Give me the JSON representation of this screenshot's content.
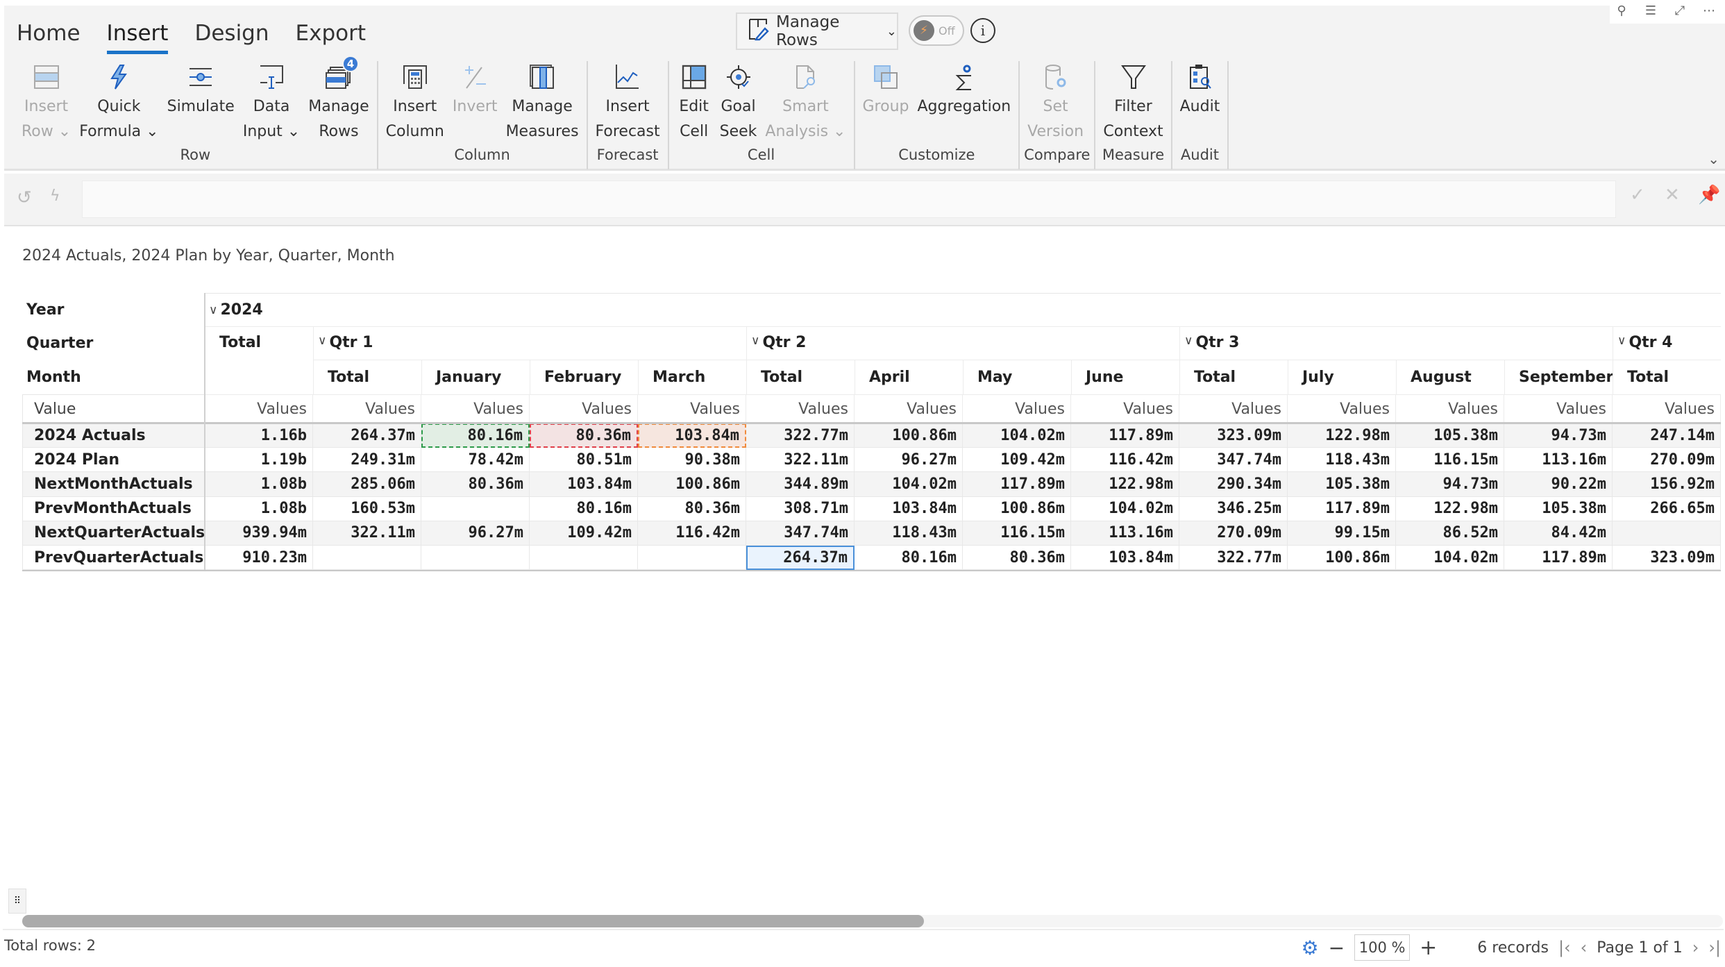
{
  "window_controls": [
    "pin-icon",
    "filter-icon",
    "expand-icon",
    "more-icon"
  ],
  "tabs": [
    {
      "label": "Home",
      "active": false
    },
    {
      "label": "Insert",
      "active": true
    },
    {
      "label": "Design",
      "active": false
    },
    {
      "label": "Export",
      "active": false
    }
  ],
  "manage_rows_dropdown": {
    "label": "Manage Rows"
  },
  "toggle": {
    "label": "Off",
    "state": "off"
  },
  "ribbon_groups": [
    {
      "label": "Row",
      "buttons": [
        {
          "line1": "Insert",
          "line2": "Row",
          "dropdown": true,
          "disabled": true,
          "icon": "insert-row-icon"
        },
        {
          "line1": "Quick",
          "line2": "Formula",
          "dropdown": true,
          "disabled": false,
          "icon": "lightning-icon"
        },
        {
          "line1": "Simulate",
          "line2": "",
          "dropdown": false,
          "disabled": false,
          "icon": "slider-icon"
        },
        {
          "line1": "Data",
          "line2": "Input",
          "dropdown": true,
          "disabled": false,
          "icon": "data-input-icon"
        },
        {
          "line1": "Manage",
          "line2": "Rows",
          "dropdown": false,
          "disabled": false,
          "icon": "manage-rows-icon",
          "badge": "4"
        }
      ]
    },
    {
      "label": "Column",
      "buttons": [
        {
          "line1": "Insert",
          "line2": "Column",
          "dropdown": false,
          "disabled": false,
          "icon": "calculator-icon"
        },
        {
          "line1": "Invert",
          "line2": "",
          "dropdown": false,
          "disabled": true,
          "icon": "plus-minus-icon"
        },
        {
          "line1": "Manage",
          "line2": "Measures",
          "dropdown": false,
          "disabled": false,
          "icon": "manage-measures-icon"
        }
      ]
    },
    {
      "label": "Forecast",
      "buttons": [
        {
          "line1": "Insert",
          "line2": "Forecast",
          "dropdown": false,
          "disabled": false,
          "icon": "line-chart-icon"
        }
      ]
    },
    {
      "label": "Cell",
      "buttons": [
        {
          "line1": "Edit",
          "line2": "Cell",
          "dropdown": false,
          "disabled": false,
          "icon": "edit-cell-icon"
        },
        {
          "line1": "Goal",
          "line2": "Seek",
          "dropdown": false,
          "disabled": false,
          "icon": "target-icon"
        },
        {
          "line1": "Smart",
          "line2": "Analysis",
          "dropdown": true,
          "disabled": true,
          "icon": "document-search-icon"
        }
      ]
    },
    {
      "label": "Customize",
      "buttons": [
        {
          "line1": "Group",
          "line2": "",
          "dropdown": false,
          "disabled": true,
          "icon": "group-icon"
        },
        {
          "line1": "Aggregation",
          "line2": "",
          "dropdown": false,
          "disabled": false,
          "icon": "sigma-gear-icon"
        }
      ]
    },
    {
      "label": "Compare",
      "buttons": [
        {
          "line1": "Set",
          "line2": "Version",
          "dropdown": false,
          "disabled": true,
          "icon": "database-gear-icon"
        }
      ]
    },
    {
      "label": "Measure",
      "buttons": [
        {
          "line1": "Filter",
          "line2": "Context",
          "dropdown": false,
          "disabled": false,
          "icon": "funnel-icon"
        }
      ]
    },
    {
      "label": "Audit",
      "buttons": [
        {
          "line1": "Audit",
          "line2": "",
          "dropdown": false,
          "disabled": false,
          "icon": "clipboard-search-icon"
        }
      ]
    }
  ],
  "formula_bar": {
    "value": "",
    "placeholder": ""
  },
  "report_title": "2024 Actuals, 2024 Plan by Year, Quarter, Month",
  "table": {
    "dim_labels": {
      "year": "Year",
      "quarter": "Quarter",
      "month": "Month",
      "value": "Value"
    },
    "year": "2024",
    "quarters": [
      {
        "label": "Total",
        "collapsible": false
      },
      {
        "label": "Qtr 1",
        "collapsible": true
      },
      {
        "label": "Qtr 2",
        "collapsible": true
      },
      {
        "label": "Qtr 3",
        "collapsible": true
      },
      {
        "label": "Qtr 4",
        "collapsible": true
      }
    ],
    "columns": [
      {
        "quarter": "Total",
        "month": ""
      },
      {
        "quarter": "Qtr 1",
        "month": "Total"
      },
      {
        "quarter": "Qtr 1",
        "month": "January"
      },
      {
        "quarter": "Qtr 1",
        "month": "February"
      },
      {
        "quarter": "Qtr 1",
        "month": "March"
      },
      {
        "quarter": "Qtr 2",
        "month": "Total"
      },
      {
        "quarter": "Qtr 2",
        "month": "April"
      },
      {
        "quarter": "Qtr 2",
        "month": "May"
      },
      {
        "quarter": "Qtr 2",
        "month": "June"
      },
      {
        "quarter": "Qtr 3",
        "month": "Total"
      },
      {
        "quarter": "Qtr 3",
        "month": "July"
      },
      {
        "quarter": "Qtr 3",
        "month": "August"
      },
      {
        "quarter": "Qtr 3",
        "month": "September"
      },
      {
        "quarter": "Qtr 4",
        "month": "Total"
      }
    ],
    "value_header": "Values",
    "rows": [
      {
        "label": "2024 Actuals",
        "values": [
          "1.16b",
          "264.37m",
          "80.16m",
          "80.36m",
          "103.84m",
          "322.77m",
          "100.86m",
          "104.02m",
          "117.89m",
          "323.09m",
          "122.98m",
          "105.38m",
          "94.73m",
          "247.14m"
        ]
      },
      {
        "label": "2024 Plan",
        "values": [
          "1.19b",
          "249.31m",
          "78.42m",
          "80.51m",
          "90.38m",
          "322.11m",
          "96.27m",
          "109.42m",
          "116.42m",
          "347.74m",
          "118.43m",
          "116.15m",
          "113.16m",
          "270.09m"
        ]
      },
      {
        "label": "NextMonthActuals",
        "values": [
          "1.08b",
          "285.06m",
          "80.36m",
          "103.84m",
          "100.86m",
          "344.89m",
          "104.02m",
          "117.89m",
          "122.98m",
          "290.34m",
          "105.38m",
          "94.73m",
          "90.22m",
          "156.92m"
        ]
      },
      {
        "label": "PrevMonthActuals",
        "values": [
          "1.08b",
          "160.53m",
          "",
          "80.16m",
          "80.36m",
          "308.71m",
          "103.84m",
          "100.86m",
          "104.02m",
          "346.25m",
          "117.89m",
          "122.98m",
          "105.38m",
          "266.65m"
        ]
      },
      {
        "label": "NextQuarterActuals",
        "values": [
          "939.94m",
          "322.11m",
          "96.27m",
          "109.42m",
          "116.42m",
          "347.74m",
          "118.43m",
          "116.15m",
          "113.16m",
          "270.09m",
          "99.15m",
          "86.52m",
          "84.42m",
          ""
        ]
      },
      {
        "label": "PrevQuarterActuals",
        "values": [
          "910.23m",
          "",
          "",
          "",
          "",
          "264.37m",
          "80.16m",
          "80.36m",
          "103.84m",
          "322.77m",
          "100.86m",
          "104.02m",
          "117.89m",
          "323.09m"
        ]
      }
    ],
    "highlights": [
      {
        "row": 0,
        "col": 2,
        "style": "green-dashed",
        "bg": "#e2eee4",
        "border": "#2e9b4a"
      },
      {
        "row": 0,
        "col": 3,
        "style": "red-dashed",
        "bg": "#f3e3e3",
        "border": "#e0404a"
      },
      {
        "row": 0,
        "col": 4,
        "style": "orange-dashed",
        "bg": "#f6e6df",
        "border": "#f08a3c"
      },
      {
        "row": 5,
        "col": 5,
        "style": "selected",
        "bg": "#eaf3fd",
        "border": "#4a90d9"
      }
    ]
  },
  "horizontal_scroll": {
    "position_fraction": 0.0,
    "visible_fraction": 0.53
  },
  "status": {
    "total_rows": "Total rows: 2",
    "zoom": "100 %",
    "records": "6 records",
    "page": "Page 1 of 1"
  }
}
